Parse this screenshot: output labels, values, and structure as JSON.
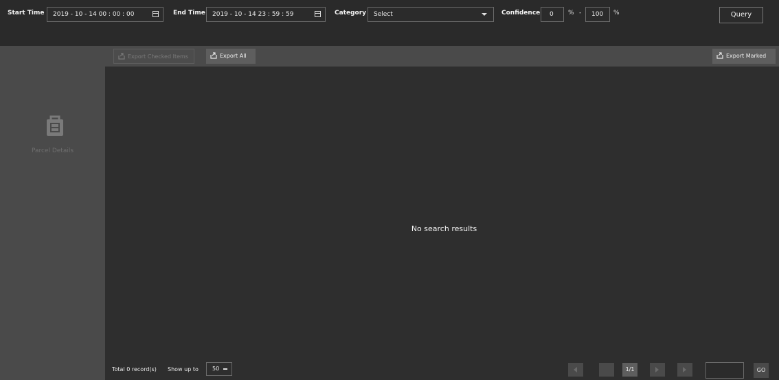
{
  "filters": {
    "start_time_label": "Start Time",
    "start_time_value": "2019 - 10 - 14  00 : 00 : 00",
    "end_time_label": "End Time",
    "end_time_value": "2019 - 10 - 14  23 : 59 : 59",
    "category_label": "Category",
    "category_value": "Select",
    "confidence_label": "Confidence",
    "confidence_min": "0",
    "confidence_max": "100",
    "percent_symbol": "%",
    "range_separator": "-",
    "query_label": "Query"
  },
  "sidebar": {
    "icon": "parcel-bag-icon",
    "label": "Parcel Details"
  },
  "toolbar": {
    "export_checked_label": "Export Checked Items",
    "export_all_label": "Export All",
    "export_marked_label": "Export Marked"
  },
  "results": {
    "empty_message": "No search results"
  },
  "pagination": {
    "total_label": "Total 0 record(s)",
    "show_up_to_label": "Show up to",
    "page_size": "50",
    "current_page": "1/1",
    "go_label": "GO"
  }
}
